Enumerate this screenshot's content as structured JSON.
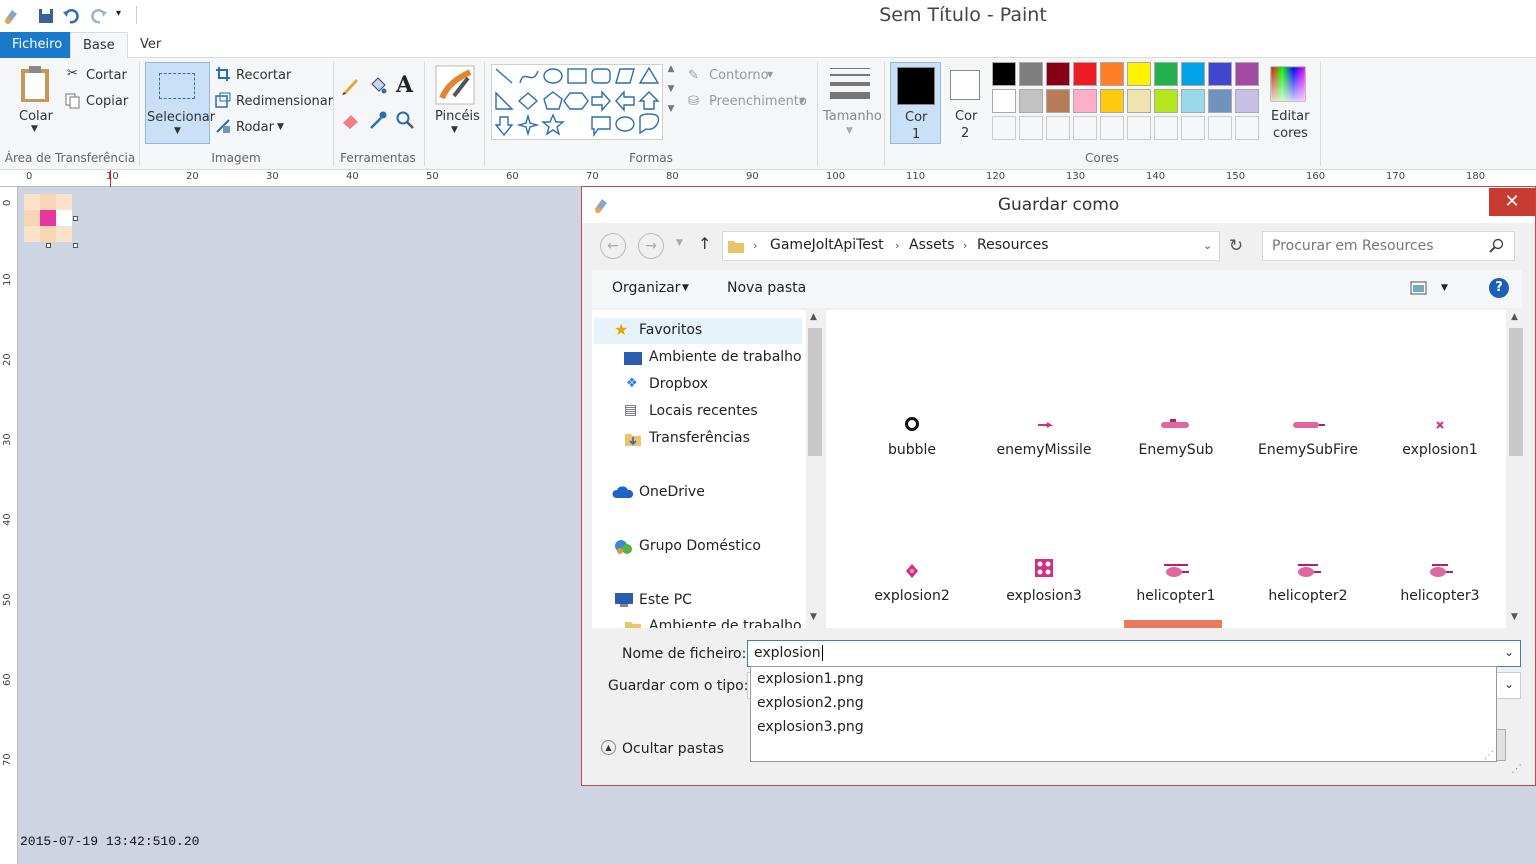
{
  "window": {
    "title": "Sem Título - Paint"
  },
  "tabs": [
    {
      "label": "Ficheiro"
    },
    {
      "label": "Base"
    },
    {
      "label": "Ver"
    }
  ],
  "ribbon": {
    "clipboard": {
      "paste": "Colar",
      "cut": "Cortar",
      "copy": "Copiar",
      "group": "Área de Transferência"
    },
    "image": {
      "select": "Selecionar",
      "crop": "Recortar",
      "resize": "Redimensionar",
      "rotate": "Rodar",
      "group": "Imagem"
    },
    "tools": {
      "group": "Ferramentas"
    },
    "brushes": {
      "label": "Pincéis"
    },
    "shapes": {
      "outline": "Contorno",
      "fill": "Preenchimento",
      "group": "Formas"
    },
    "size": {
      "label": "Tamanho"
    },
    "colors": {
      "color1": "Cor",
      "color1_num": "1",
      "color2": "Cor",
      "color2_num": "2",
      "edit": "Editar",
      "edit2": "cores",
      "group": "Cores",
      "palette_row1": [
        "#000000",
        "#7f7f7f",
        "#880015",
        "#ed1c24",
        "#ff7f27",
        "#fff200",
        "#22b14c",
        "#00a2e8",
        "#3f48cc",
        "#a349a4"
      ],
      "palette_row2": [
        "#ffffff",
        "#c3c3c3",
        "#b97a57",
        "#ffaec9",
        "#ffc90e",
        "#efe4b0",
        "#b5e61d",
        "#99d9ea",
        "#7092be",
        "#c8bfe7"
      ]
    }
  },
  "ruler": {
    "h": [
      "0",
      "10",
      "20",
      "30",
      "40",
      "50",
      "60",
      "70",
      "80",
      "90",
      "100",
      "110",
      "120",
      "130",
      "140",
      "150",
      "160",
      "170",
      "180"
    ],
    "v": [
      "0",
      "10",
      "20",
      "30",
      "40",
      "50",
      "60",
      "70"
    ]
  },
  "status": {
    "text": "2015-07-19 13:42:510.20"
  },
  "dialog": {
    "title": "Guardar como",
    "breadcrumb": [
      "GameJoltApiTest",
      "Assets",
      "Resources"
    ],
    "search_placeholder": "Procurar em Resources",
    "organize": "Organizar",
    "new_folder": "Nova pasta",
    "nav": [
      "Favoritos",
      "Ambiente de trabalho",
      "Dropbox",
      "Locais recentes",
      "Transferências",
      "OneDrive",
      "Grupo Doméstico",
      "Este PC",
      "Ambiente de trabalho"
    ],
    "files": [
      "bubble",
      "enemyMissile",
      "EnemySub",
      "EnemySubFire",
      "explosion1",
      "explosion2",
      "explosion3",
      "helicopter1",
      "helicopter2",
      "helicopter3"
    ],
    "filename_label": "Nome de ficheiro:",
    "filename_value": "explosion",
    "filetype_label": "Guardar com o tipo:",
    "hide_folders": "Ocultar pastas",
    "suggestions": [
      "explosion1.png",
      "explosion2.png",
      "explosion3.png"
    ]
  }
}
